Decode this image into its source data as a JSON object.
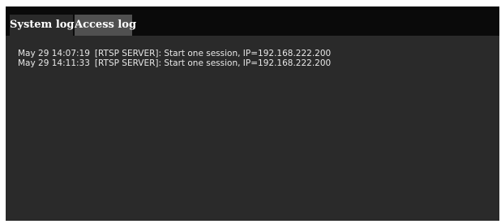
{
  "tabs": [
    {
      "label": "System log",
      "active": false
    },
    {
      "label": "Access log",
      "active": true
    }
  ],
  "log": {
    "entries": [
      {
        "time": "May 29 14:07:19",
        "message": "[RTSP SERVER]: Start one session, IP=192.168.222.200"
      },
      {
        "time": "May 29 14:11:33",
        "message": "[RTSP SERVER]: Start one session, IP=192.168.222.200"
      }
    ]
  },
  "colors": {
    "tabbar_bg": "#0a0a0a",
    "panel_bg": "#2a2a2a",
    "active_tab_bg": "#505050",
    "text": "#e6e6e6"
  }
}
